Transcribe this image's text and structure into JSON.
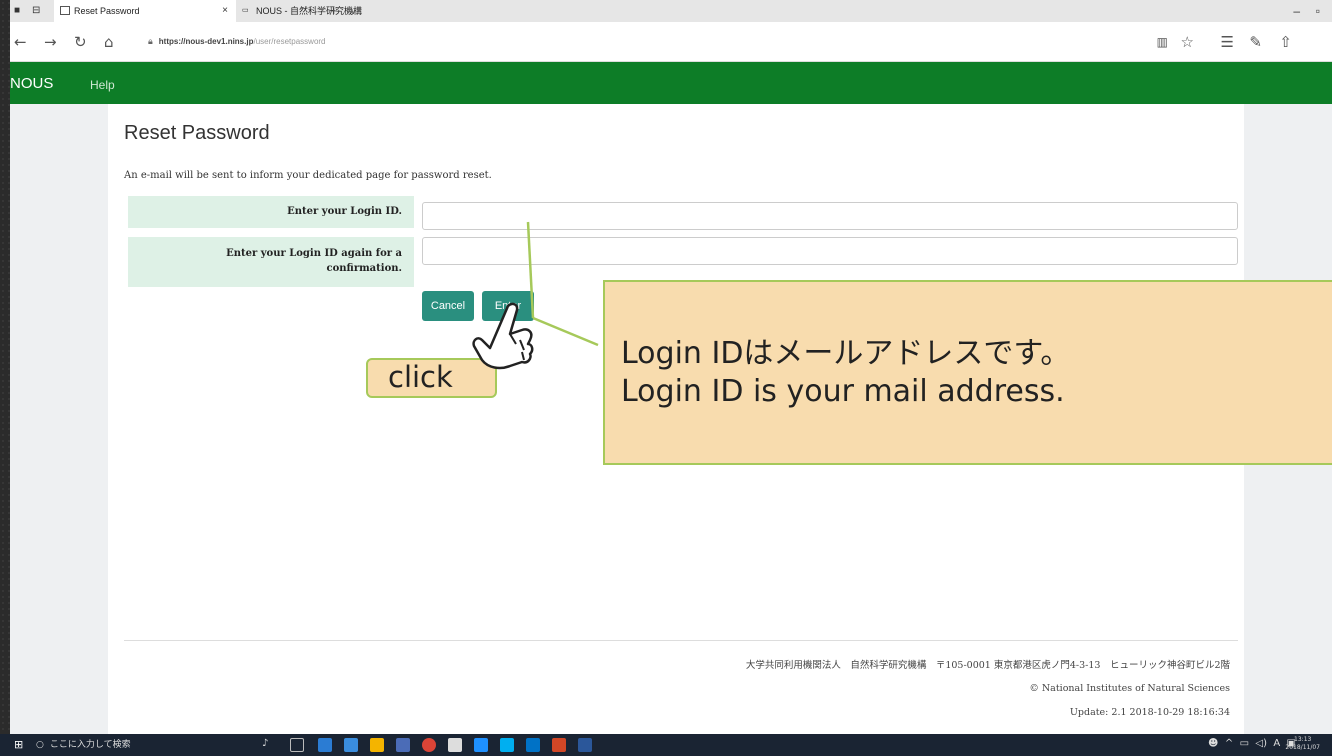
{
  "browser": {
    "tabs": [
      {
        "label": "Reset Password",
        "close": "×"
      },
      {
        "label": "NOUS - 自然科学研究機構",
        "close": ""
      }
    ],
    "new_tab": "+",
    "tab_dropdown": "∨",
    "url_host": "https://nous-dev1.nins.jp",
    "url_path": "/user/resetpassword"
  },
  "app": {
    "brand": "NOUS",
    "help": "Help"
  },
  "page": {
    "title": "Reset Password",
    "description": "An e-mail will be sent to inform your dedicated page for password reset.",
    "login_id_label": "Enter your Login ID.",
    "login_id_confirm_label_1": "Enter your Login ID again for a",
    "login_id_confirm_label_2": "confirmation.",
    "login_id_value": "",
    "login_id_confirm_value": "",
    "cancel_label": "Cancel",
    "enter_label": "Enter"
  },
  "footer": {
    "address": "大学共同利用機関法人　自然科学研究機構　〒105-0001 東京都港区虎ノ門4-3-13　ヒューリック神谷町ビル2階",
    "copyright": "© National Institutes of Natural Sciences",
    "update": "Update: 2.1 2018-10-29 18:16:34"
  },
  "annotation": {
    "callout_line1": "Login IDはメールアドレスです。",
    "callout_line2": "Login ID is your mail address.",
    "click_label": "click"
  },
  "taskbar": {
    "search_placeholder": "ここに入力して検索",
    "time": "13:13",
    "date": "2018/11/07",
    "ime": "A"
  },
  "colors": {
    "nav_green": "#0d7d27",
    "button_teal": "#2a8f7f",
    "label_bg": "#def1e6",
    "callout_bg": "#f8dcae",
    "callout_border": "#a6c95a"
  }
}
